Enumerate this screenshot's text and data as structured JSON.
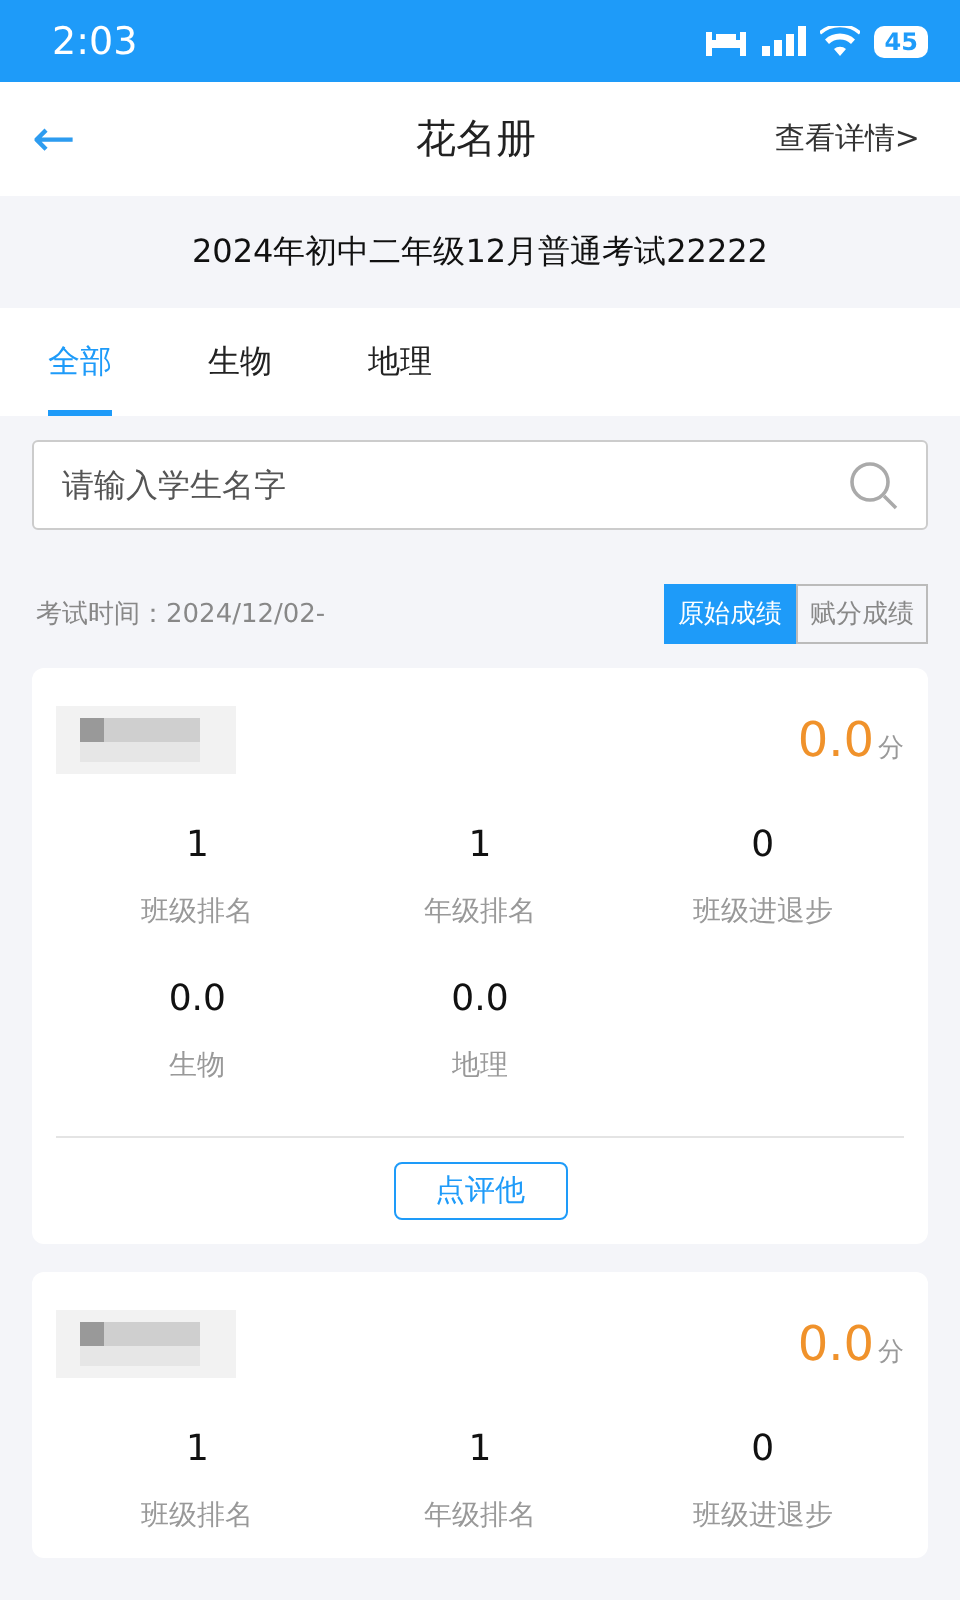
{
  "status_bar": {
    "time": "2:03",
    "battery": "45"
  },
  "header": {
    "back_icon": "←",
    "title": "花名册",
    "action": "查看详情>"
  },
  "exam_title": "2024年初中二年级12月普通考试22222",
  "tabs": [
    {
      "label": "全部",
      "selected": true
    },
    {
      "label": "生物",
      "selected": false
    },
    {
      "label": "地理",
      "selected": false
    }
  ],
  "search": {
    "placeholder": "请输入学生名字"
  },
  "exam_time": "考试时间：2024/12/02-",
  "score_modes": [
    {
      "label": "原始成绩",
      "selected": true
    },
    {
      "label": "赋分成绩",
      "selected": false
    }
  ],
  "students": [
    {
      "score": "0.0",
      "unit": "分",
      "stats": [
        {
          "value": "1",
          "label": "班级排名"
        },
        {
          "value": "1",
          "label": "年级排名"
        },
        {
          "value": "0",
          "label": "班级进退步"
        },
        {
          "value": "0.0",
          "label": "生物"
        },
        {
          "value": "0.0",
          "label": "地理"
        }
      ],
      "comment_button": "点评他"
    },
    {
      "score": "0.0",
      "unit": "分",
      "stats": [
        {
          "value": "1",
          "label": "班级排名"
        },
        {
          "value": "1",
          "label": "年级排名"
        },
        {
          "value": "0",
          "label": "班级进退步"
        }
      ]
    }
  ]
}
